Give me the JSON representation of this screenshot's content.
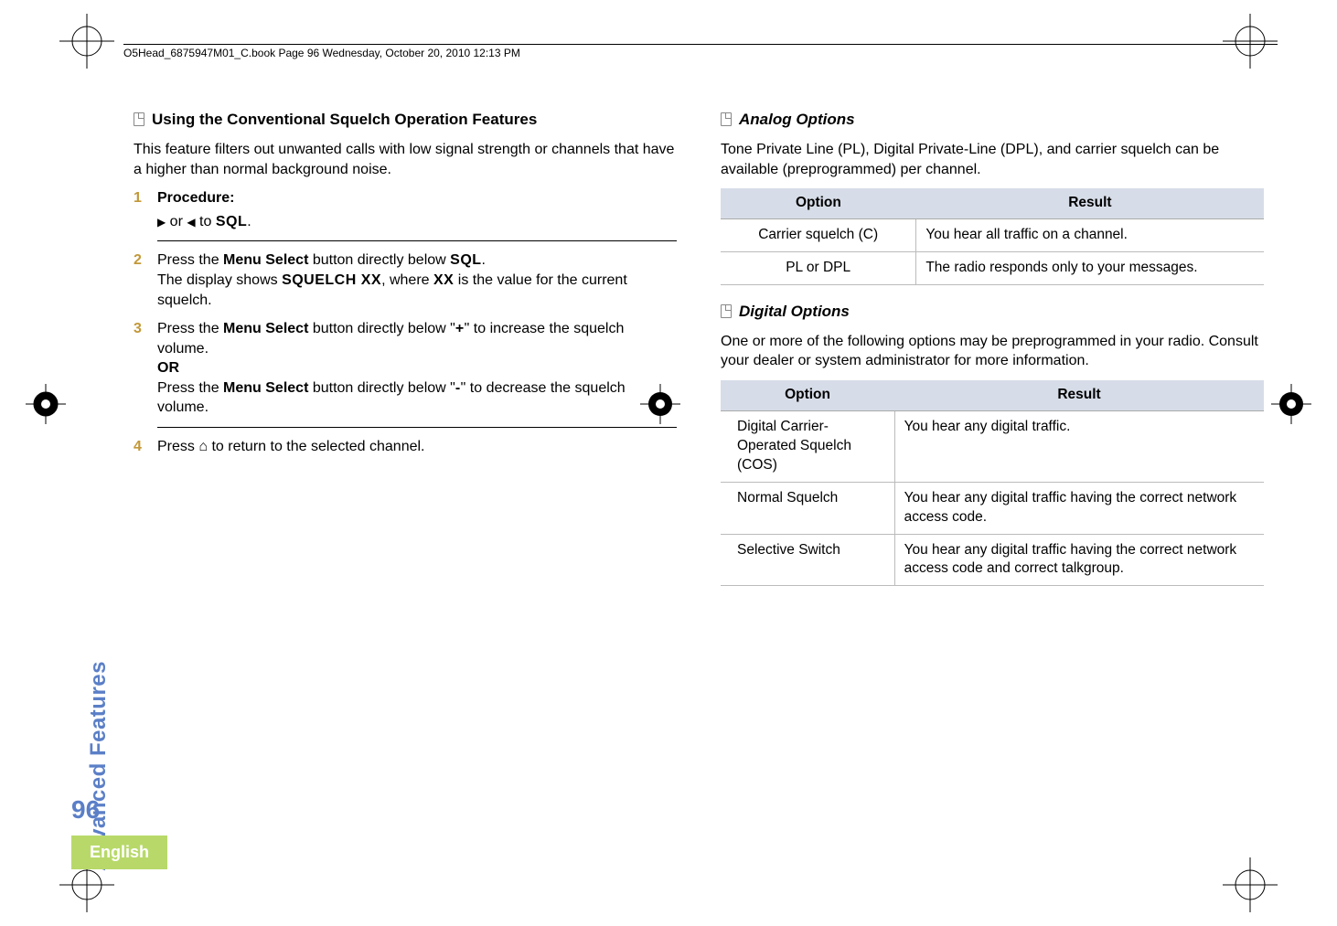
{
  "header": {
    "running": "O5Head_6875947M01_C.book  Page 96  Wednesday, October 20, 2010  12:13 PM"
  },
  "side": {
    "section_label": "Advanced Features",
    "page_number": "96",
    "language": "English"
  },
  "left": {
    "heading": "Using the Conventional Squelch Operation Features",
    "intro": "This feature filters out unwanted calls with low signal strength or channels that have a higher than normal background noise.",
    "steps": {
      "s1": {
        "num": "1",
        "label": "Procedure:",
        "linepre": "",
        "or_word": " or ",
        "to_word": " to ",
        "sql": "SQL",
        "dot": "."
      },
      "s2": {
        "num": "2",
        "l1a": "Press the ",
        "menu": "Menu Select",
        "l1b": " button directly below ",
        "sql": "SQL",
        "l1c": ".",
        "l2a": "The display shows ",
        "squelchxx": "SQUELCH XX",
        "l2b": ", where ",
        "xx": "XX",
        "l2c": " is the value for the current squelch."
      },
      "s3": {
        "num": "3",
        "l1a": "Press the ",
        "menu": "Menu Select",
        "l1b": " button directly below \"",
        "plus": "+",
        "l1c": "\" to increase the squelch volume.",
        "or": "OR",
        "l2a": "Press the ",
        "l2b": " button directly below \"",
        "minus": "-",
        "l2c": "\" to decrease the squelch volume."
      },
      "s4": {
        "num": "4",
        "a": "Press ",
        "b": " to return to the selected channel."
      }
    }
  },
  "right": {
    "analog": {
      "heading": "Analog Options",
      "intro": "Tone Private Line (PL), Digital Private-Line (DPL), and carrier squelch can be available (preprogrammed) per channel.",
      "th_opt": "Option",
      "th_res": "Result",
      "rows": [
        {
          "opt": "Carrier squelch (C)",
          "res": "You hear all traffic on a channel."
        },
        {
          "opt": "PL or DPL",
          "res": "The radio responds only to your messages."
        }
      ]
    },
    "digital": {
      "heading": "Digital Options",
      "intro": "One or more of the following options may be preprogrammed in your radio. Consult your dealer or system administrator for more information.",
      "th_opt": "Option",
      "th_res": "Result",
      "rows": [
        {
          "opt": "Digital Carrier-Operated Squelch (COS)",
          "res": "You hear any digital traffic."
        },
        {
          "opt": "Normal Squelch",
          "res": "You hear any digital traffic having the correct network access code."
        },
        {
          "opt": "Selective Switch",
          "res": "You hear any digital traffic having the correct network access code and correct talkgroup."
        }
      ]
    }
  }
}
